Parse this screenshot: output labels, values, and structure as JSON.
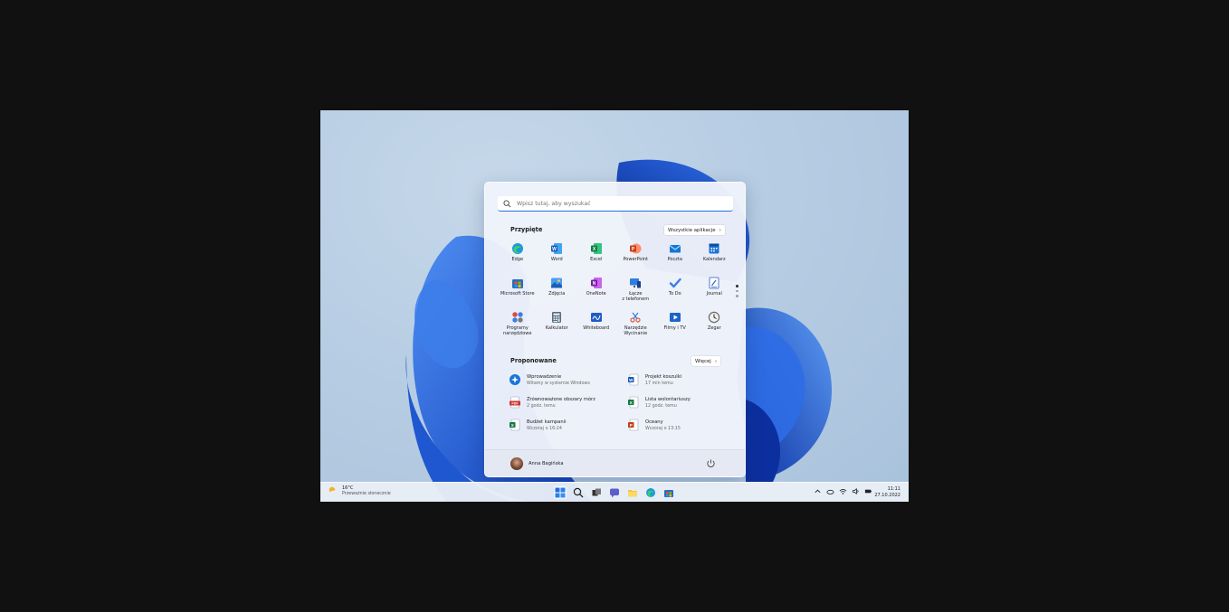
{
  "search": {
    "placeholder": "Wpisz tutaj, aby wyszukać"
  },
  "pinned": {
    "title": "Przypięte",
    "all_apps_label": "Wszystkie aplikacje",
    "apps": [
      {
        "label": "Edge",
        "icon": "edge-icon"
      },
      {
        "label": "Word",
        "icon": "word-icon"
      },
      {
        "label": "Excel",
        "icon": "excel-icon"
      },
      {
        "label": "PowerPoint",
        "icon": "powerpoint-icon"
      },
      {
        "label": "Poczta",
        "icon": "mail-icon"
      },
      {
        "label": "Kalendarz",
        "icon": "calendar-icon"
      },
      {
        "label": "Microsoft Store",
        "icon": "store-icon"
      },
      {
        "label": "Zdjęcia",
        "icon": "photos-icon"
      },
      {
        "label": "OneNote",
        "icon": "onenote-icon"
      },
      {
        "label": "Łącze\nz telefonem",
        "icon": "phone-link-icon"
      },
      {
        "label": "To Do",
        "icon": "todo-icon"
      },
      {
        "label": "Journal",
        "icon": "journal-icon"
      },
      {
        "label": "Programy\nnarzędziowe",
        "icon": "tools-icon"
      },
      {
        "label": "Kalkulator",
        "icon": "calculator-icon"
      },
      {
        "label": "Whiteboard",
        "icon": "whiteboard-icon"
      },
      {
        "label": "Narzędzie\nWycinanie",
        "icon": "snipping-tool-icon"
      },
      {
        "label": "Filmy i TV",
        "icon": "movies-tv-icon"
      },
      {
        "label": "Zegar",
        "icon": "clock-icon"
      }
    ]
  },
  "recommended": {
    "title": "Proponowane",
    "more_label": "Więcej",
    "items": [
      {
        "name": "Wprowadzenie",
        "sub": "Witamy w systemie Windows",
        "icon": "get-started-icon"
      },
      {
        "name": "Projekt koszulki",
        "sub": "17 min temu",
        "icon": "word-doc-icon"
      },
      {
        "name": "Zrównoważone obszary mórz",
        "sub": "2 godz. temu",
        "icon": "pdf-icon"
      },
      {
        "name": "Lista wolontariuszy",
        "sub": "12 godz. temu",
        "icon": "excel-doc-icon"
      },
      {
        "name": "Budżet kampanii",
        "sub": "Wczoraj o 16:24",
        "icon": "excel-doc-icon"
      },
      {
        "name": "Oceany",
        "sub": "Wczoraj o 13:15",
        "icon": "powerpoint-doc-icon"
      }
    ]
  },
  "user": {
    "name": "Anna Bagińska"
  },
  "taskbar": {
    "weather": {
      "temp": "16°C",
      "desc": "Przeważnie słonecznie"
    },
    "apps": [
      "start-icon",
      "search-icon",
      "task-view-icon",
      "chat-icon",
      "file-explorer-icon",
      "edge-icon",
      "store-icon"
    ],
    "clock": {
      "time": "11:11",
      "date": "27.10.2022"
    }
  },
  "colors": {
    "accent": "#2a6fd6",
    "wallpaper_bloom": "#1a56d8"
  }
}
